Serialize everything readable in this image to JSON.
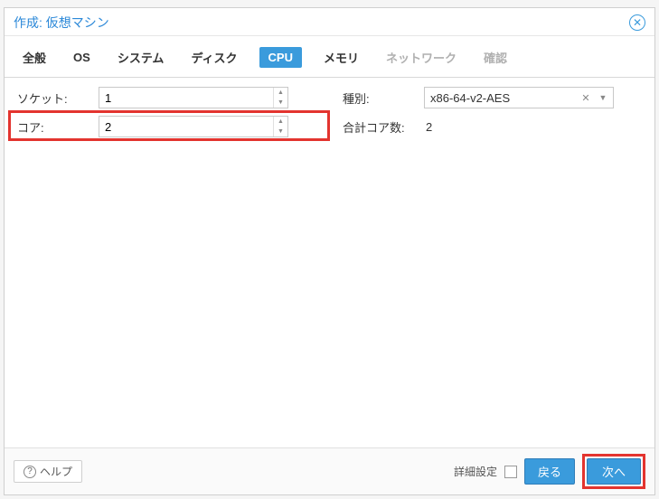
{
  "dialog": {
    "title": "作成: 仮想マシン"
  },
  "tabs": {
    "general": "全般",
    "os": "OS",
    "system": "システム",
    "disk": "ディスク",
    "cpu": "CPU",
    "memory": "メモリ",
    "network": "ネットワーク",
    "confirm": "確認"
  },
  "form": {
    "sockets_label": "ソケット:",
    "sockets_value": "1",
    "cores_label": "コア:",
    "cores_value": "2",
    "type_label": "種別:",
    "type_value": "x86-64-v2-AES",
    "total_cores_label": "合計コア数:",
    "total_cores_value": "2"
  },
  "footer": {
    "help": "ヘルプ",
    "advanced_label": "詳細設定",
    "back": "戻る",
    "next": "次へ"
  }
}
